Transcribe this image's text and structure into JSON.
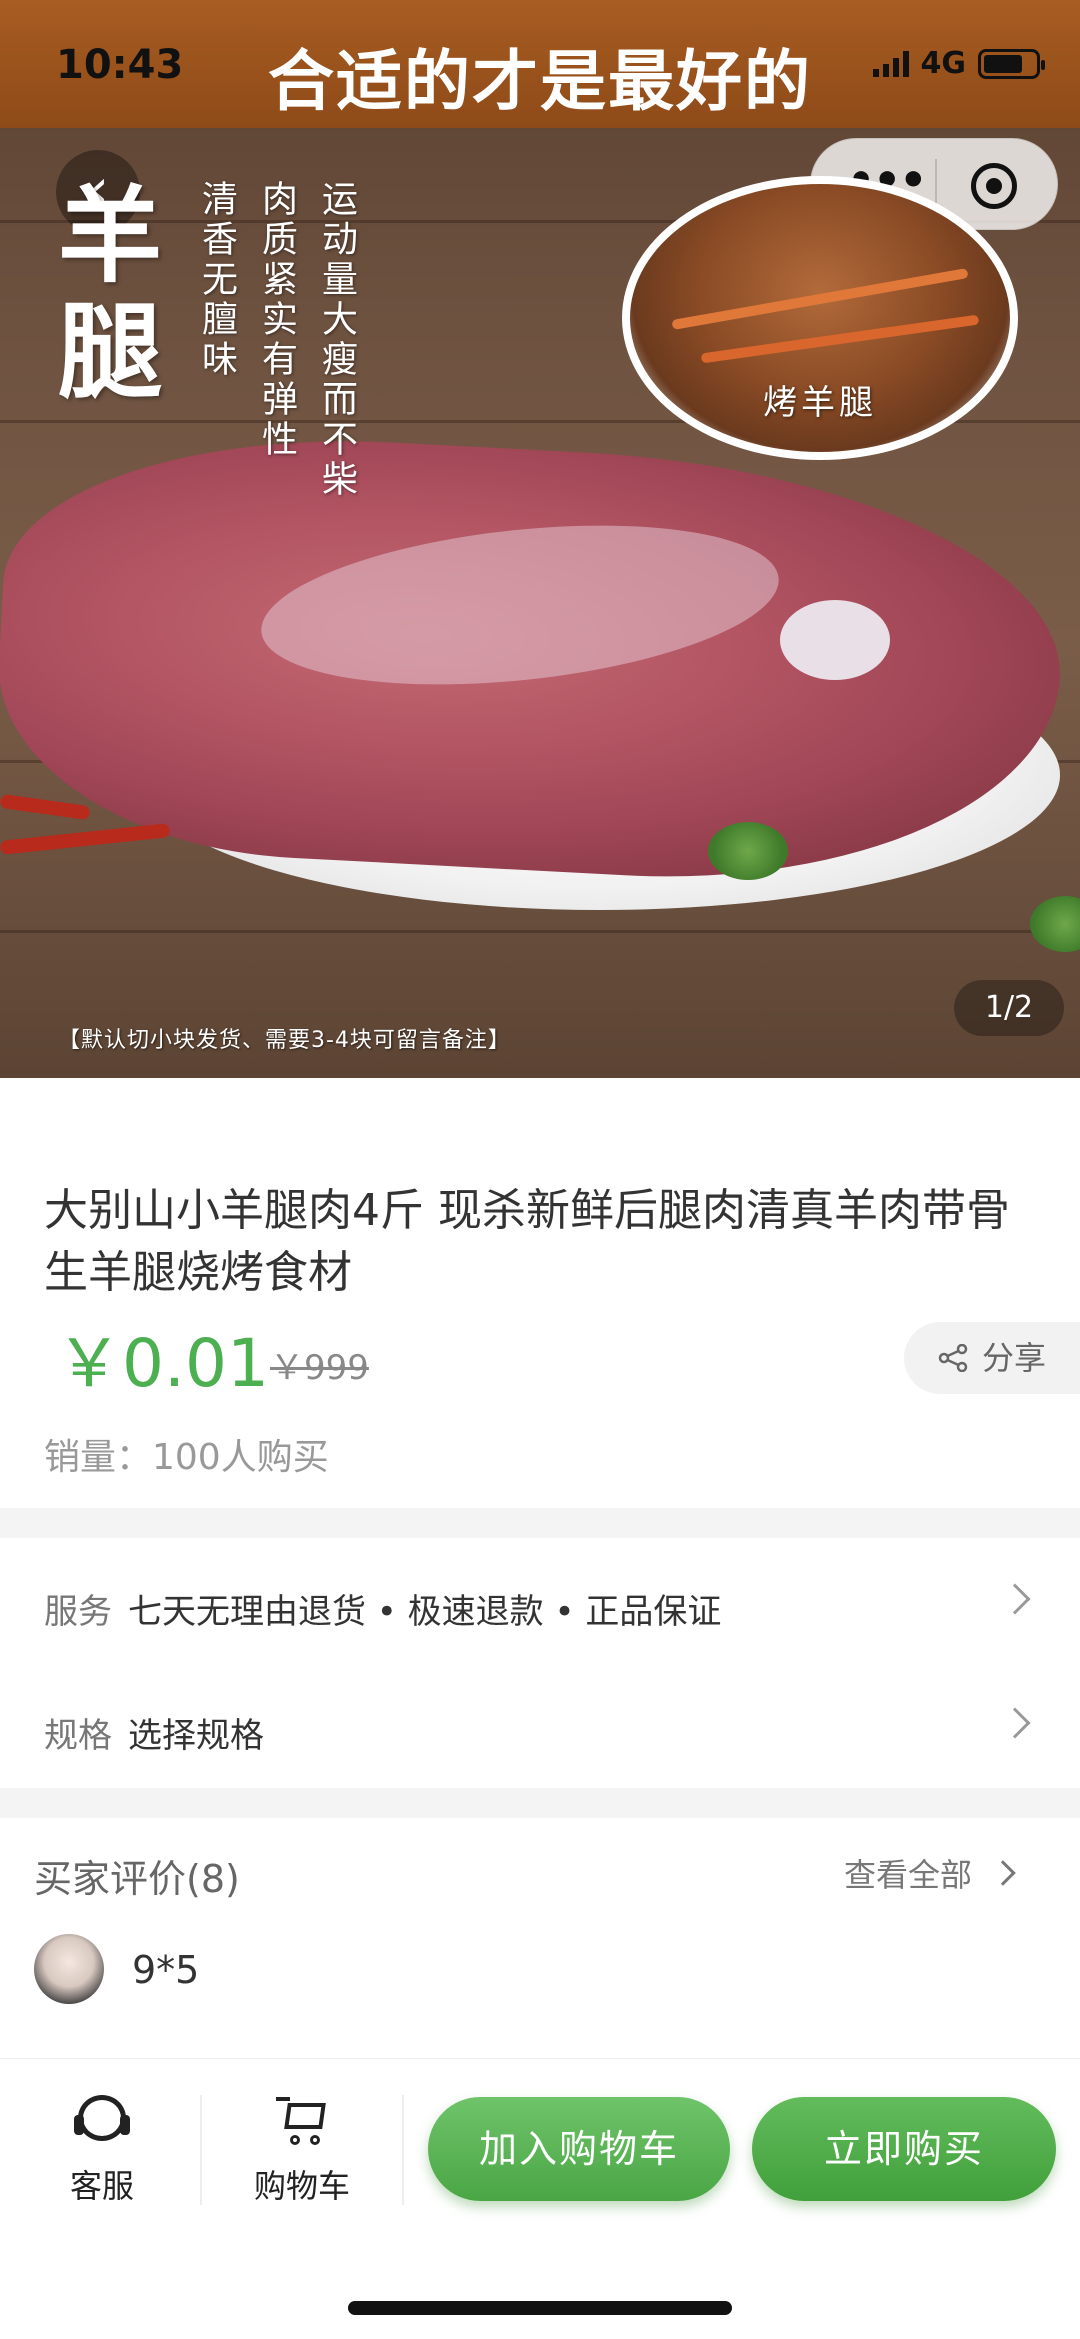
{
  "status_bar": {
    "time": "10:43",
    "network": "4G"
  },
  "hero": {
    "banner_text": "合适的才是最好的",
    "big_title_line1": "羊",
    "big_title_line2": "腿",
    "vertical_text_1": "清香无膻味",
    "vertical_text_2": "肉质紧实有弹性",
    "vertical_text_3": "运动量大瘦而不柴",
    "inset_label": "烤羊腿",
    "shipping_note": "【默认切小块发货、需要3-4块可留言备注】",
    "pager": "1/2"
  },
  "nav": {
    "back_icon": "chevron-left-icon",
    "menu_icon": "more-dots-icon",
    "close_icon": "target-icon"
  },
  "product": {
    "title": "大别山小羊腿肉4斤 现杀新鲜后腿肉清真羊肉带骨生羊腿烧烤食材",
    "price": "￥0.01",
    "original_price": "￥999",
    "share_label": "分享",
    "sales": "销量：100人购买"
  },
  "service": {
    "label": "服务",
    "value": "七天无理由退货 • 极速退款 • 正品保证"
  },
  "spec": {
    "label": "规格",
    "value": "选择规格"
  },
  "reviews": {
    "title": "买家评价(8)",
    "view_all": "查看全部",
    "first_reviewer": "9*5"
  },
  "bottom_bar": {
    "service_label": "客服",
    "cart_label": "购物车",
    "add_to_cart": "加入购物车",
    "buy_now": "立即购买"
  },
  "colors": {
    "accent_green": "#4caf50",
    "banner_brown": "#9a5220"
  }
}
